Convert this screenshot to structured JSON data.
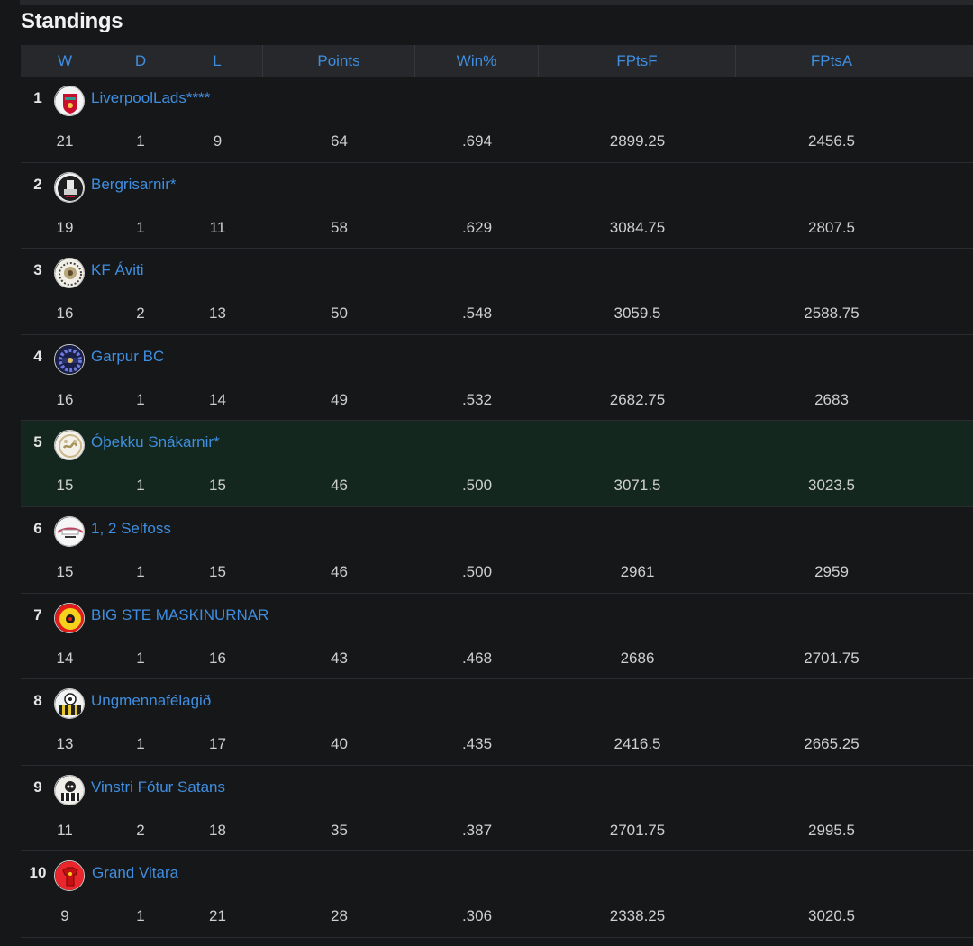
{
  "page": {
    "title": "Standings"
  },
  "columns": {
    "w": "W",
    "d": "D",
    "l": "L",
    "points": "Points",
    "win_pct": "Win%",
    "fpts_f": "FPtsF",
    "fpts_a": "FPtsA"
  },
  "teams": [
    {
      "rank": "1",
      "name": "LiverpoolLads****",
      "w": "21",
      "d": "1",
      "l": "9",
      "points": "64",
      "win_pct": ".694",
      "fpts_f": "2899.25",
      "fpts_a": "2456.5",
      "logo": "liverpool-crest-icon"
    },
    {
      "rank": "2",
      "name": "Bergrisarnir*",
      "w": "19",
      "d": "1",
      "l": "11",
      "points": "58",
      "win_pct": ".629",
      "fpts_f": "3084.75",
      "fpts_a": "2807.5",
      "logo": "giant-icon"
    },
    {
      "rank": "3",
      "name": "KF Áviti",
      "w": "16",
      "d": "2",
      "l": "13",
      "points": "50",
      "win_pct": ".548",
      "fpts_f": "3059.5",
      "fpts_a": "2588.75",
      "logo": "lion-crest-icon"
    },
    {
      "rank": "4",
      "name": "Garpur BC",
      "w": "16",
      "d": "1",
      "l": "14",
      "points": "49",
      "win_pct": ".532",
      "fpts_f": "2682.75",
      "fpts_a": "2683",
      "logo": "gear-badge-icon"
    },
    {
      "rank": "5",
      "name": "Óþekku Snákarnir*",
      "w": "15",
      "d": "1",
      "l": "15",
      "points": "46",
      "win_pct": ".500",
      "fpts_f": "3071.5",
      "fpts_a": "3023.5",
      "logo": "snake-badge-icon"
    },
    {
      "rank": "6",
      "name": "1, 2 Selfoss",
      "w": "15",
      "d": "1",
      "l": "15",
      "points": "46",
      "win_pct": ".500",
      "fpts_f": "2961",
      "fpts_a": "2959",
      "logo": "selfoss-badge-icon"
    },
    {
      "rank": "7",
      "name": "BIG STE MASKINURNAR",
      "w": "14",
      "d": "1",
      "l": "16",
      "points": "43",
      "win_pct": ".468",
      "fpts_f": "2686",
      "fpts_a": "2701.75",
      "logo": "yellow-red-ball-icon"
    },
    {
      "rank": "8",
      "name": "Ungmennafélagið",
      "w": "13",
      "d": "1",
      "l": "17",
      "points": "40",
      "win_pct": ".435",
      "fpts_f": "2416.5",
      "fpts_a": "2665.25",
      "logo": "football-striped-icon"
    },
    {
      "rank": "9",
      "name": "Vinstri Fótur Satans",
      "w": "11",
      "d": "2",
      "l": "18",
      "points": "35",
      "win_pct": ".387",
      "fpts_f": "2701.75",
      "fpts_a": "2995.5",
      "logo": "skull-striped-icon"
    },
    {
      "rank": "10",
      "name": "Grand Vitara",
      "w": "9",
      "d": "1",
      "l": "21",
      "points": "28",
      "win_pct": ".306",
      "fpts_f": "2338.25",
      "fpts_a": "3020.5",
      "logo": "red-jersey-icon"
    }
  ],
  "highlight_rank": "5",
  "colors": {
    "link": "#3f8ee0",
    "highlight_row": "#14271f",
    "header_bg": "#26282b",
    "page_bg": "#161719"
  }
}
